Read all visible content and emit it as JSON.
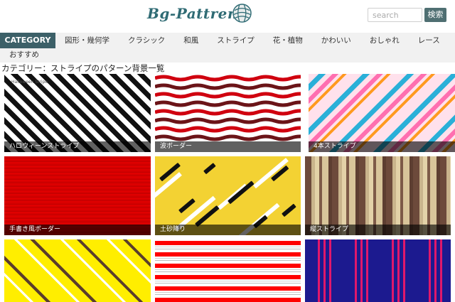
{
  "site": {
    "logo": "Bg-Pattrens"
  },
  "search": {
    "placeholder": "search",
    "button_label": "検索"
  },
  "nav": {
    "category_label": "CATEGORY",
    "items": [
      "図形・幾何学",
      "クラシック",
      "和風",
      "ストライプ",
      "花・植物",
      "かわいい",
      "おしゃれ",
      "レース"
    ],
    "recommended_label": "おすすめ"
  },
  "page": {
    "title": "カテゴリー：ストライプのパターン背景一覧"
  },
  "cards": [
    {
      "caption": "ハロウィーンストライプ",
      "tag": "Halloween Stripe"
    },
    {
      "caption": "波ボーダー",
      "tag": ""
    },
    {
      "caption": "4本ストライプ",
      "tag": ""
    },
    {
      "caption": "手書き風ボーダー",
      "tag": ""
    },
    {
      "caption": "土砂降り",
      "tag": ""
    },
    {
      "caption": "縦ストライプ",
      "tag": ""
    },
    {
      "caption": "",
      "tag": ""
    },
    {
      "caption": "",
      "tag": ""
    },
    {
      "caption": "",
      "tag": ""
    }
  ],
  "colors": {
    "accent": "#3c6068",
    "logo": "#2f6b74",
    "search_button": "#4f6f72"
  }
}
